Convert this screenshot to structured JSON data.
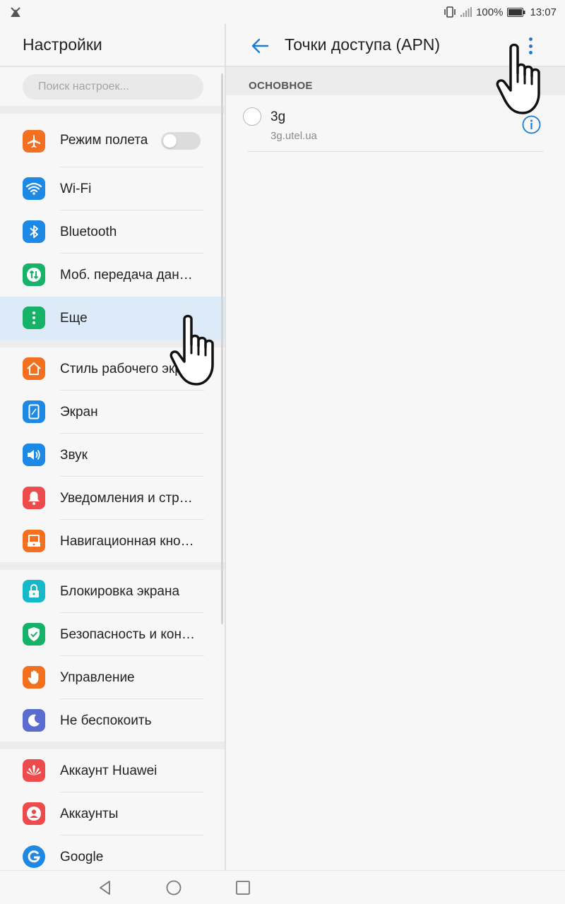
{
  "status_bar": {
    "battery": "100%",
    "time": "13:07",
    "icons": [
      "app-notification-icon",
      "vibrate-icon",
      "signal-icon",
      "battery-icon"
    ]
  },
  "left_pane": {
    "title": "Настройки",
    "search_placeholder": "Поиск настроек...",
    "groups": [
      [
        {
          "label": "Режим полета",
          "icon": "airplane-icon",
          "color": "#f37021",
          "toggle": false
        },
        {
          "label": "Wi-Fi",
          "icon": "wifi-icon",
          "color": "#1e88e5"
        },
        {
          "label": "Bluetooth",
          "icon": "bluetooth-icon",
          "color": "#1e88e5"
        },
        {
          "label": "Моб. передача данных",
          "icon": "mobile-data-icon",
          "color": "#16b26a"
        },
        {
          "label": "Еще",
          "icon": "more-vertical-icon",
          "color": "#16b26a",
          "selected": true
        }
      ],
      [
        {
          "label": "Стиль рабочего экрана",
          "icon": "home-icon",
          "color": "#f37021"
        },
        {
          "label": "Экран",
          "icon": "display-icon",
          "color": "#1e88e5"
        },
        {
          "label": "Звук",
          "icon": "sound-icon",
          "color": "#1e88e5"
        },
        {
          "label": "Уведомления и строка состояния",
          "icon": "bell-icon",
          "color": "#ee4c4c"
        },
        {
          "label": "Навигационная кнопка",
          "icon": "nav-key-icon",
          "color": "#f37021"
        }
      ],
      [
        {
          "label": "Блокировка экрана",
          "icon": "lock-icon",
          "color": "#16b9c9"
        },
        {
          "label": "Безопасность и конфиденциальность",
          "icon": "shield-icon",
          "color": "#16b26a"
        },
        {
          "label": "Управление",
          "icon": "hand-icon",
          "color": "#f37021"
        },
        {
          "label": "Не беспокоить",
          "icon": "moon-icon",
          "color": "#5a6cd0"
        }
      ],
      [
        {
          "label": "Аккаунт Huawei",
          "icon": "huawei-icon",
          "color": "#ee4c4c"
        },
        {
          "label": "Аккаунты",
          "icon": "account-icon",
          "color": "#ee4c4c"
        },
        {
          "label": "Google",
          "icon": "google-icon",
          "color": "#1e88e5"
        }
      ]
    ]
  },
  "right_pane": {
    "title": "Точки доступа (APN)",
    "section": "ОСНОВНОЕ",
    "apns": [
      {
        "name": "3g",
        "url": "3g.utel.ua",
        "selected": false
      }
    ]
  },
  "colors": {
    "accent": "#1c7cd5",
    "selected_bg": "#dcebf7"
  }
}
